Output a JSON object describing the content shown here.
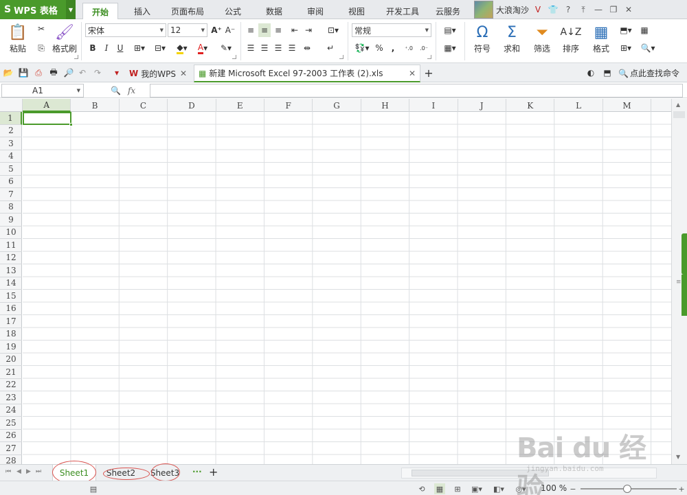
{
  "app": {
    "name": "WPS 表格",
    "logo_glyph": "S",
    "accent": "#4a9a2b"
  },
  "ribbon_tabs": [
    {
      "label": "开始",
      "active": true
    },
    {
      "label": "插入"
    },
    {
      "label": "页面布局"
    },
    {
      "label": "公式"
    },
    {
      "label": "数据"
    },
    {
      "label": "审阅"
    },
    {
      "label": "视图"
    },
    {
      "label": "开发工具"
    },
    {
      "label": "云服务"
    }
  ],
  "user": {
    "name": "大浪淘沙"
  },
  "home": {
    "paste_label": "粘贴",
    "format_painter_label": "格式刷",
    "font_name": "宋体",
    "font_size": "12",
    "number_format": "常规",
    "symbol_label": "符号",
    "sum_label": "求和",
    "filter_label": "筛选",
    "sort_label": "排序",
    "format_label": "格式",
    "bold": "B",
    "italic": "I",
    "underline": "U",
    "percent": "%",
    "comma": ",",
    "inc_decimal": ".0\n.00",
    "dec_decimal": ".00\n.0",
    "font_color": "#e02020",
    "fill_color": "#f5d400"
  },
  "doc_tabs": [
    {
      "label": "我的WPS"
    },
    {
      "label": "新建 Microsoft Excel 97-2003 工作表 (2).xls",
      "active": true
    }
  ],
  "search_commands": "点此查找命令",
  "formula_bar": {
    "cell_ref": "A1",
    "fx": "fx",
    "value": ""
  },
  "columns": [
    "A",
    "B",
    "C",
    "D",
    "E",
    "F",
    "G",
    "H",
    "I",
    "J",
    "K",
    "L",
    "M"
  ],
  "rows": [
    "1",
    "2",
    "3",
    "4",
    "5",
    "6",
    "7",
    "8",
    "9",
    "10",
    "11",
    "12",
    "13",
    "14",
    "15",
    "16",
    "17",
    "18",
    "19",
    "20",
    "21",
    "22",
    "23",
    "24",
    "25",
    "26",
    "27",
    "28"
  ],
  "selected_cell": "A1",
  "sheets": [
    {
      "label": "Sheet1",
      "active": true
    },
    {
      "label": "Sheet2"
    },
    {
      "label": "Sheet3"
    }
  ],
  "zoom": "100 %",
  "watermark": {
    "brand": "Bai du 经验",
    "url": "jingyan.baidu.com"
  }
}
